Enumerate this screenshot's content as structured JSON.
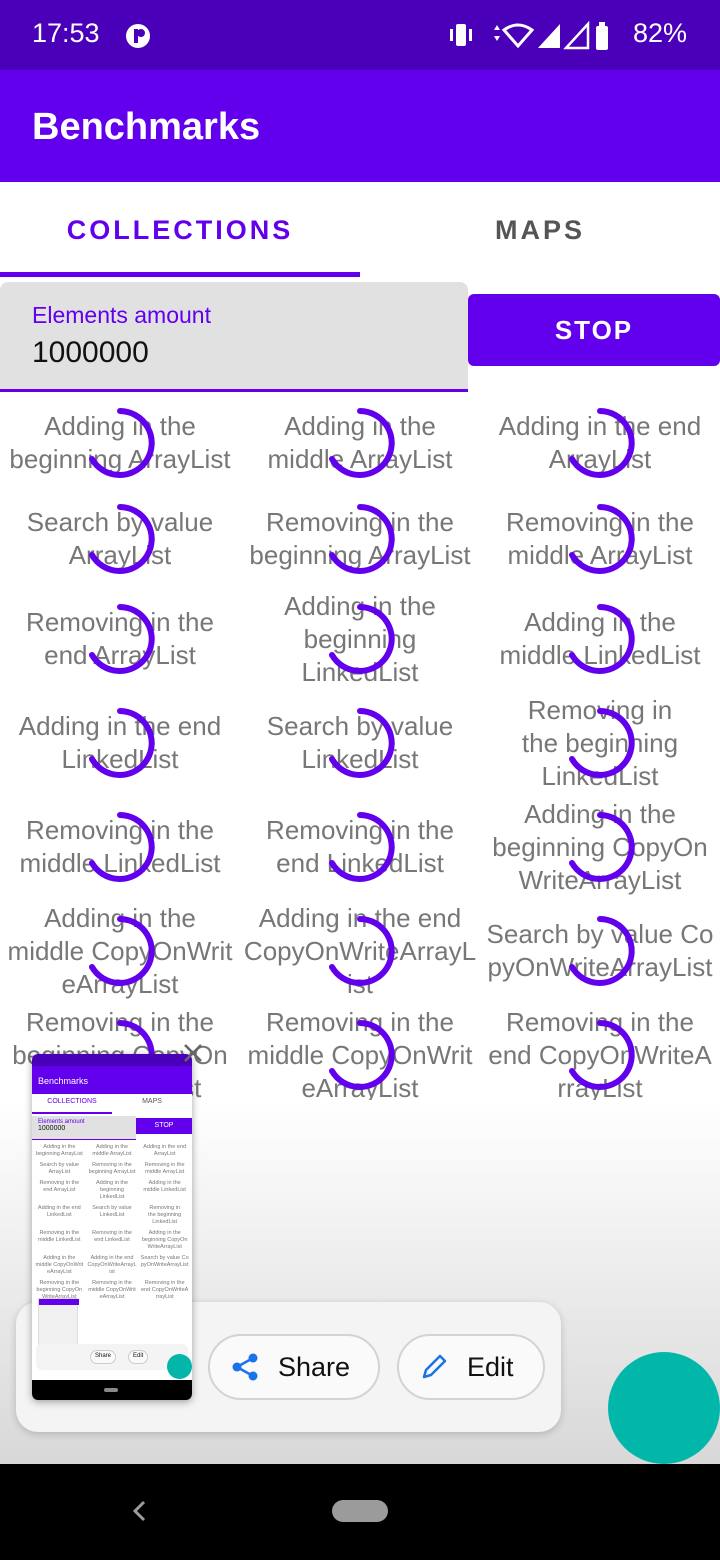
{
  "status_bar": {
    "time": "17:53",
    "battery": "82%"
  },
  "app_bar": {
    "title": "Benchmarks"
  },
  "tabs": [
    {
      "label": "COLLECTIONS",
      "selected": true
    },
    {
      "label": "MAPS",
      "selected": false
    }
  ],
  "elements_field": {
    "label": "Elements amount",
    "value": "1000000"
  },
  "stop_button": {
    "label": "STOP"
  },
  "benchmarks": [
    {
      "lines": [
        "Adding in the",
        "beginning ArrayList"
      ]
    },
    {
      "lines": [
        "Adding in the",
        "middle ArrayList"
      ]
    },
    {
      "lines": [
        "Adding in the end",
        "ArrayList"
      ]
    },
    {
      "lines": [
        "Search by value",
        "ArrayList"
      ]
    },
    {
      "lines": [
        "Removing in the",
        "beginning ArrayList"
      ]
    },
    {
      "lines": [
        "Removing in the",
        "middle ArrayList"
      ]
    },
    {
      "lines": [
        "Removing in the",
        "end ArrayList"
      ]
    },
    {
      "lines": [
        "Adding in the",
        "beginning",
        "LinkedList"
      ]
    },
    {
      "lines": [
        "Adding in the",
        "middle LinkedList"
      ]
    },
    {
      "lines": [
        "Adding in the end",
        "LinkedList"
      ]
    },
    {
      "lines": [
        "Search by value",
        "LinkedList"
      ]
    },
    {
      "lines": [
        "Removing in",
        "the beginning",
        "LinkedList"
      ]
    },
    {
      "lines": [
        "Removing in the",
        "middle LinkedList"
      ]
    },
    {
      "lines": [
        "Removing in the",
        "end LinkedList"
      ]
    },
    {
      "lines": [
        "Adding in the",
        "beginning CopyOn",
        "WriteArrayList"
      ]
    },
    {
      "lines": [
        "Adding in the",
        "middle CopyOnWrit",
        "eArrayList"
      ]
    },
    {
      "lines": [
        "Adding in the end",
        "CopyOnWriteArrayL",
        "ist"
      ]
    },
    {
      "lines": [
        "Search by value Co",
        "pyOnWriteArrayList"
      ]
    },
    {
      "lines": [
        "Removing in the",
        "beginning CopyOn",
        "WriteArrayList"
      ]
    },
    {
      "lines": [
        "Removing in the",
        "middle CopyOnWrit",
        "eArrayList"
      ]
    },
    {
      "lines": [
        "Removing in the",
        "end CopyOnWriteA",
        "rrayList"
      ]
    }
  ],
  "screenshot_toolbar": {
    "share_label": "Share",
    "edit_label": "Edit"
  },
  "colors": {
    "primary": "#6200ee",
    "status_bar": "#4a00b8",
    "fab": "#02b7a9",
    "spinner": "#6200ee"
  }
}
